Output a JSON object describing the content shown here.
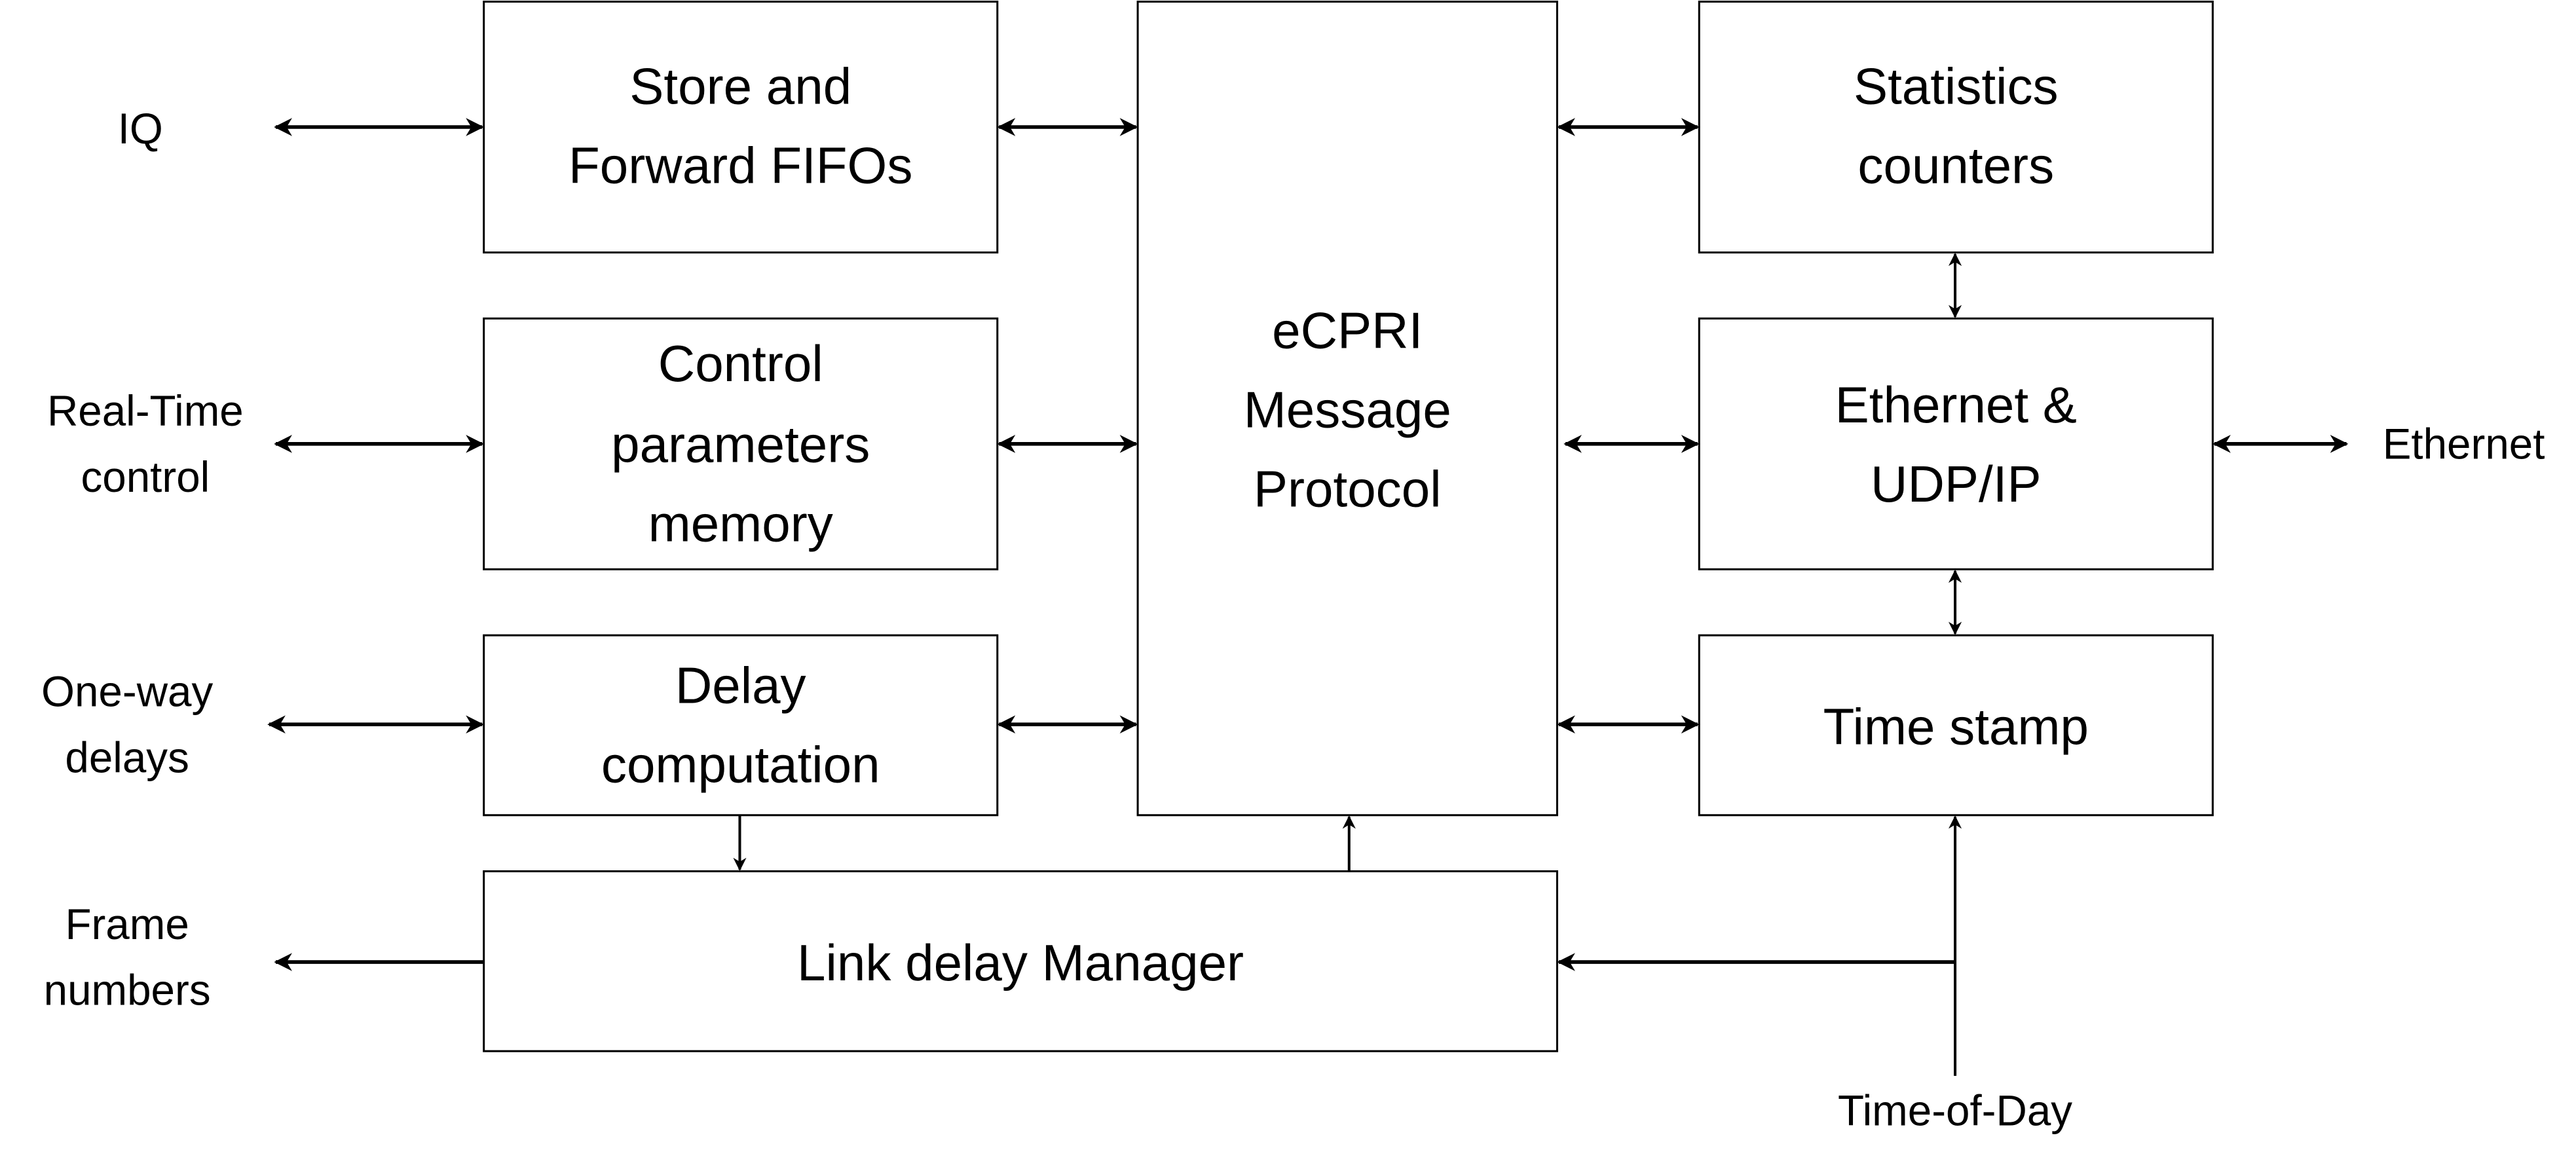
{
  "blocks": {
    "store": [
      "Store and",
      "Forward FIFOs"
    ],
    "control": [
      "Control",
      "parameters",
      "memory"
    ],
    "delay": [
      "Delay",
      "computation"
    ],
    "link": [
      "Link delay Manager"
    ],
    "ecpri": [
      "eCPRI",
      "Message",
      "Protocol"
    ],
    "stats": [
      "Statistics",
      "counters"
    ],
    "ethernet": [
      "Ethernet &",
      "UDP/IP"
    ],
    "timestamp": [
      "Time stamp"
    ]
  },
  "external_labels": {
    "iq": [
      "IQ"
    ],
    "realtime": [
      "Real-Time",
      "control"
    ],
    "oneway": [
      "One-way",
      "delays"
    ],
    "frame": [
      "Frame",
      "numbers"
    ],
    "ethernet": [
      "Ethernet"
    ],
    "tod": [
      "Time-of-Day"
    ]
  }
}
